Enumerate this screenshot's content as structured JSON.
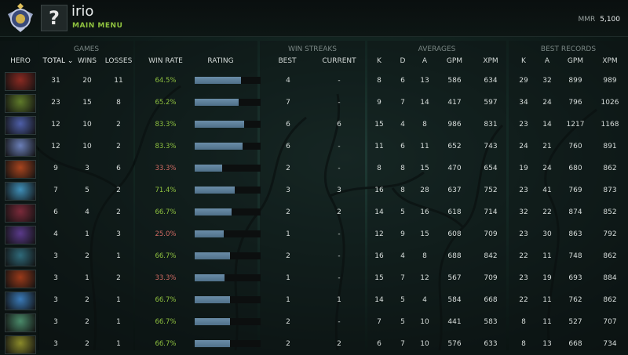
{
  "topbar": {
    "username": "irio",
    "main_menu": "MAIN MENU",
    "avatar_glyph": "?",
    "mmr_label": "MMR",
    "mmr_value": "5,100"
  },
  "groups": {
    "games": "GAMES",
    "win_streaks": "WIN STREAKS",
    "averages": "AVERAGES",
    "best_records": "BEST RECORDS"
  },
  "headers": {
    "hero": "HERO",
    "total": "TOTAL ⌄",
    "wins": "WINS",
    "losses": "LOSSES",
    "win_rate": "WIN RATE",
    "rating": "RATING",
    "best": "BEST",
    "current": "CURRENT",
    "avg_k": "K",
    "avg_d": "D",
    "avg_a": "A",
    "avg_gpm": "GPM",
    "avg_xpm": "XPM",
    "best_k": "K",
    "best_a": "A",
    "best_gpm": "GPM",
    "best_xpm": "XPM"
  },
  "rows": [
    {
      "hero_color": "#8a2a22",
      "total": "31",
      "wins": "20",
      "losses": "11",
      "win_rate": "64.5%",
      "good": true,
      "rating": 0.7,
      "best": "4",
      "current": "-",
      "k": "8",
      "d": "6",
      "a": "13",
      "gpm": "586",
      "xpm": "634",
      "bk": "29",
      "ba": "32",
      "bgpm": "899",
      "bxpm": "989"
    },
    {
      "hero_color": "#5f7a2a",
      "total": "23",
      "wins": "15",
      "losses": "8",
      "win_rate": "65.2%",
      "good": true,
      "rating": 0.67,
      "best": "7",
      "current": "-",
      "k": "9",
      "d": "7",
      "a": "14",
      "gpm": "417",
      "xpm": "597",
      "bk": "34",
      "ba": "24",
      "bgpm": "796",
      "bxpm": "1026"
    },
    {
      "hero_color": "#4e5fa8",
      "total": "12",
      "wins": "10",
      "losses": "2",
      "win_rate": "83.3%",
      "good": true,
      "rating": 0.75,
      "best": "6",
      "current": "6",
      "k": "15",
      "d": "4",
      "a": "8",
      "gpm": "986",
      "xpm": "831",
      "bk": "23",
      "ba": "14",
      "bgpm": "1217",
      "bxpm": "1168"
    },
    {
      "hero_color": "#6b7fb8",
      "total": "12",
      "wins": "10",
      "losses": "2",
      "win_rate": "83.3%",
      "good": true,
      "rating": 0.73,
      "best": "6",
      "current": "-",
      "k": "11",
      "d": "6",
      "a": "11",
      "gpm": "652",
      "xpm": "743",
      "bk": "24",
      "ba": "21",
      "bgpm": "760",
      "bxpm": "891"
    },
    {
      "hero_color": "#a8451f",
      "total": "9",
      "wins": "3",
      "losses": "6",
      "win_rate": "33.3%",
      "good": false,
      "rating": 0.42,
      "best": "2",
      "current": "-",
      "k": "8",
      "d": "8",
      "a": "15",
      "gpm": "470",
      "xpm": "654",
      "bk": "19",
      "ba": "24",
      "bgpm": "680",
      "bxpm": "862"
    },
    {
      "hero_color": "#3f8fb8",
      "total": "7",
      "wins": "5",
      "losses": "2",
      "win_rate": "71.4%",
      "good": true,
      "rating": 0.61,
      "best": "3",
      "current": "3",
      "k": "16",
      "d": "8",
      "a": "28",
      "gpm": "637",
      "xpm": "752",
      "bk": "23",
      "ba": "41",
      "bgpm": "769",
      "bxpm": "873"
    },
    {
      "hero_color": "#7a2a3a",
      "total": "6",
      "wins": "4",
      "losses": "2",
      "win_rate": "66.7%",
      "good": true,
      "rating": 0.56,
      "best": "2",
      "current": "2",
      "k": "14",
      "d": "5",
      "a": "16",
      "gpm": "618",
      "xpm": "714",
      "bk": "32",
      "ba": "22",
      "bgpm": "874",
      "bxpm": "852"
    },
    {
      "hero_color": "#5a3a8a",
      "total": "4",
      "wins": "1",
      "losses": "3",
      "win_rate": "25.0%",
      "good": false,
      "rating": 0.44,
      "best": "1",
      "current": "-",
      "k": "12",
      "d": "9",
      "a": "15",
      "gpm": "608",
      "xpm": "709",
      "bk": "23",
      "ba": "30",
      "bgpm": "863",
      "bxpm": "792"
    },
    {
      "hero_color": "#2f6a7a",
      "total": "3",
      "wins": "2",
      "losses": "1",
      "win_rate": "66.7%",
      "good": true,
      "rating": 0.54,
      "best": "2",
      "current": "-",
      "k": "16",
      "d": "4",
      "a": "8",
      "gpm": "688",
      "xpm": "842",
      "bk": "22",
      "ba": "11",
      "bgpm": "748",
      "bxpm": "862"
    },
    {
      "hero_color": "#9a3a1a",
      "total": "3",
      "wins": "1",
      "losses": "2",
      "win_rate": "33.3%",
      "good": false,
      "rating": 0.45,
      "best": "1",
      "current": "-",
      "k": "15",
      "d": "7",
      "a": "12",
      "gpm": "567",
      "xpm": "709",
      "bk": "23",
      "ba": "19",
      "bgpm": "693",
      "bxpm": "884"
    },
    {
      "hero_color": "#3a7ab8",
      "total": "3",
      "wins": "2",
      "losses": "1",
      "win_rate": "66.7%",
      "good": true,
      "rating": 0.54,
      "best": "1",
      "current": "1",
      "k": "14",
      "d": "5",
      "a": "4",
      "gpm": "584",
      "xpm": "668",
      "bk": "22",
      "ba": "11",
      "bgpm": "762",
      "bxpm": "862"
    },
    {
      "hero_color": "#4a8a6a",
      "total": "3",
      "wins": "2",
      "losses": "1",
      "win_rate": "66.7%",
      "good": true,
      "rating": 0.54,
      "best": "2",
      "current": "-",
      "k": "7",
      "d": "5",
      "a": "10",
      "gpm": "441",
      "xpm": "583",
      "bk": "8",
      "ba": "11",
      "bgpm": "527",
      "bxpm": "707"
    },
    {
      "hero_color": "#8a8a2a",
      "total": "3",
      "wins": "2",
      "losses": "1",
      "win_rate": "66.7%",
      "good": true,
      "rating": 0.54,
      "best": "2",
      "current": "2",
      "k": "6",
      "d": "7",
      "a": "10",
      "gpm": "576",
      "xpm": "633",
      "bk": "8",
      "ba": "13",
      "bgpm": "668",
      "bxpm": "734"
    }
  ]
}
